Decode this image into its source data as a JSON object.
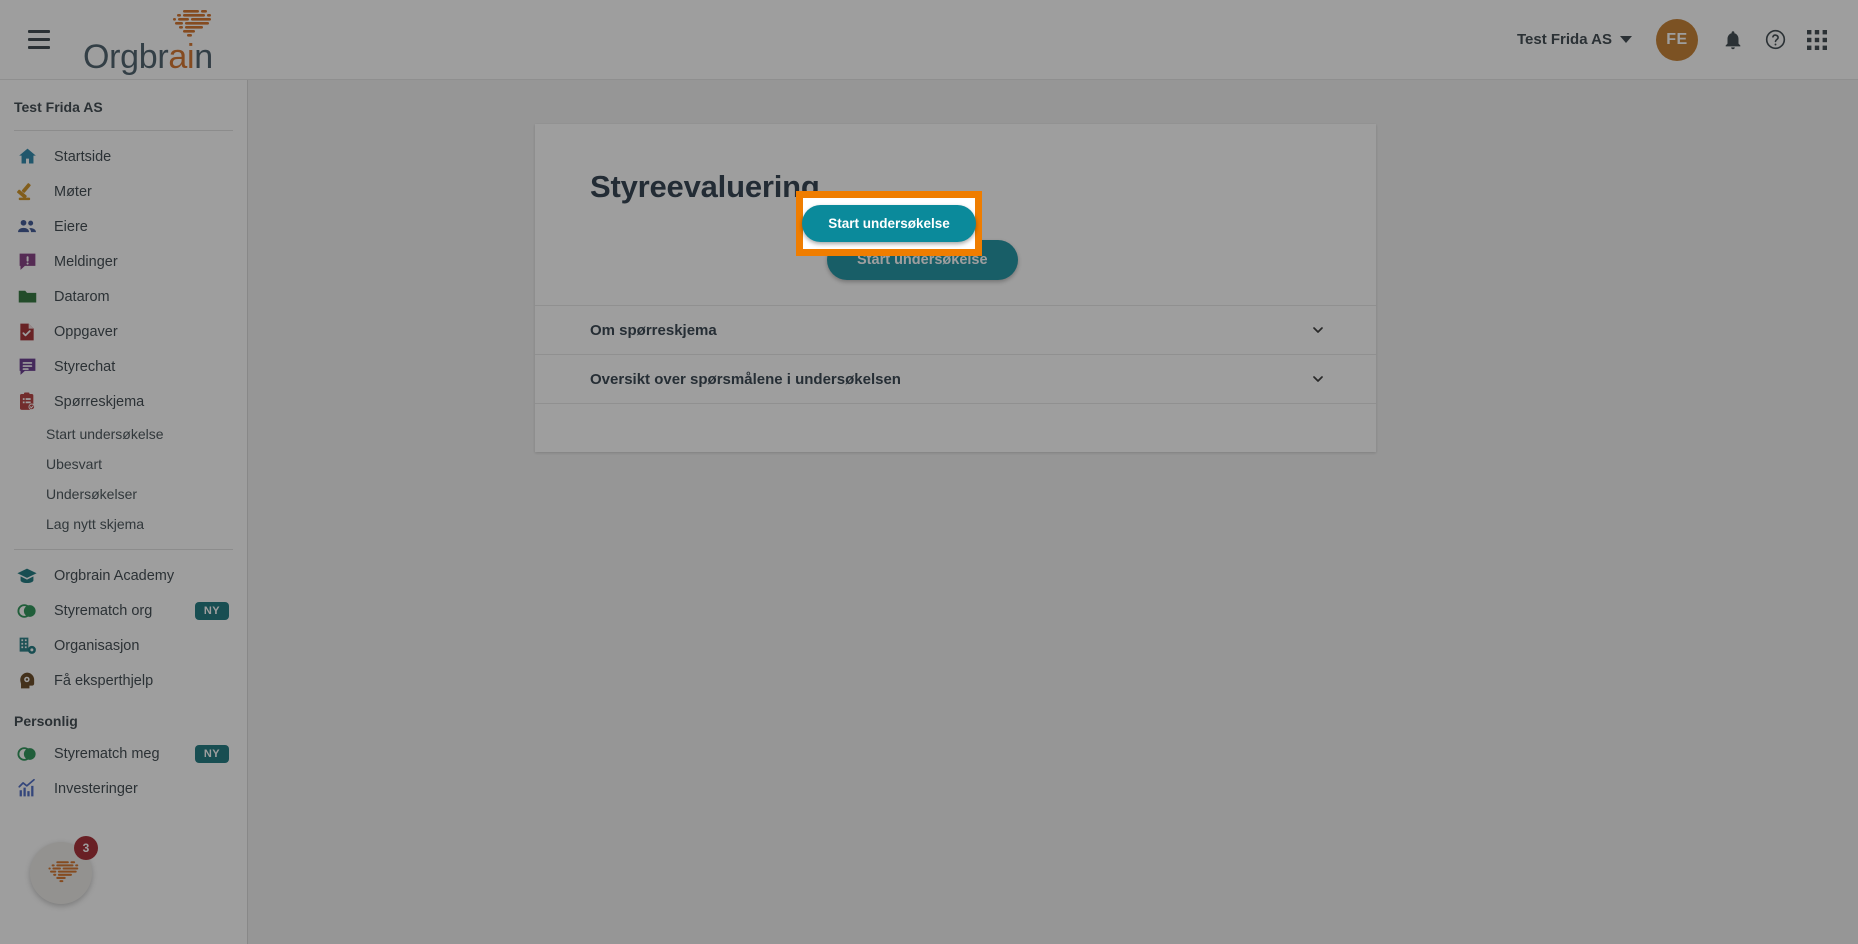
{
  "header": {
    "menu_icon": "hamburger-menu-icon",
    "logo_text_prefix": "Orgbr",
    "logo_text_accent": "ai",
    "logo_text_suffix": "n",
    "org_switcher_label": "Test Frida AS",
    "avatar_initials": "FE",
    "avatar_color": "#c2751f",
    "icons": [
      "notifications-bell-icon",
      "help-circle-icon",
      "apps-grid-icon"
    ]
  },
  "sidebar": {
    "org_name": "Test Frida AS",
    "items": [
      {
        "label": "Startside",
        "icon": "home-icon",
        "color": "#1d7fa4"
      },
      {
        "label": "Møter",
        "icon": "gavel-icon",
        "color": "#cd8a13"
      },
      {
        "label": "Eiere",
        "icon": "people-icon",
        "color": "#2f4a8c"
      },
      {
        "label": "Meldinger",
        "icon": "message-alert-icon",
        "color": "#7b2f78"
      },
      {
        "label": "Datarom",
        "icon": "folder-icon",
        "color": "#1f6b2c"
      },
      {
        "label": "Oppgaver",
        "icon": "task-document-icon",
        "color": "#9e1f24"
      },
      {
        "label": "Styrechat",
        "icon": "chat-bubble-icon",
        "color": "#5b2a86"
      },
      {
        "label": "Spørreskjema",
        "icon": "clipboard-check-icon",
        "color": "#b03030"
      }
    ],
    "sub_items": [
      {
        "label": "Start undersøkelse"
      },
      {
        "label": "Ubesvart"
      },
      {
        "label": "Undersøkelser"
      },
      {
        "label": "Lag nytt skjema"
      }
    ],
    "secondary_items": [
      {
        "label": "Orgbrain Academy",
        "icon": "graduation-cap-icon",
        "color": "#0c6e76",
        "badge": ""
      },
      {
        "label": "Styrematch org",
        "icon": "venn-circles-icon",
        "color": "#1a8a4a",
        "badge": "NY"
      },
      {
        "label": "Organisasjon",
        "icon": "org-building-icon",
        "color": "#0c6e76",
        "badge": ""
      },
      {
        "label": "Få eksperthjelp",
        "icon": "expert-head-icon",
        "color": "#5b3a12",
        "badge": ""
      }
    ],
    "personal_title": "Personlig",
    "personal_items": [
      {
        "label": "Styrematch meg",
        "icon": "venn-circles-icon",
        "color": "#1a8a4a",
        "badge": "NY"
      },
      {
        "label": "Investeringer",
        "icon": "chart-growth-icon",
        "color": "#3f5fbf",
        "badge": ""
      }
    ],
    "badge_color": "#0c6e76"
  },
  "floating_widget": {
    "icon": "orgbrain-brain-icon",
    "badge_count": "3",
    "badge_color": "#9e1b23"
  },
  "main": {
    "card_title": "Styreevaluering",
    "primary_button": "Start undersøkelse",
    "primary_button_color": "#0b8a9b",
    "accordions": [
      {
        "label": "Om spørreskjema",
        "chevron": "chevron-down-icon"
      },
      {
        "label": "Oversikt over spørsmålene i undersøkelsen",
        "chevron": "chevron-down-icon"
      }
    ]
  },
  "highlight": {
    "target_label": "Start undersøkelse",
    "border_color": "#ef7d00",
    "overlay_color": "rgba(40,40,40,0.45)"
  }
}
